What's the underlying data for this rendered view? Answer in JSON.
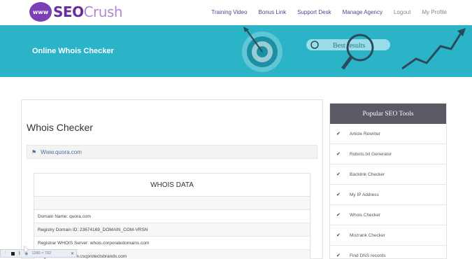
{
  "logo": {
    "globe_text": "www",
    "brand_a": "SEO",
    "brand_b": "Crush"
  },
  "nav": [
    {
      "label": "Training Video"
    },
    {
      "label": "Bonus Link"
    },
    {
      "label": "Support Desk"
    },
    {
      "label": "Manage Agency"
    },
    {
      "label": "Logout"
    },
    {
      "label": "My Profile"
    }
  ],
  "banner": {
    "title": "Online Whois Checker",
    "search_text": "Best results"
  },
  "main": {
    "title": "Whois Checker",
    "domain": "Www.quora.com",
    "whois_header": "WHOIS DATA",
    "rows": [
      "Domain Name: quora.com",
      "Registry Domain ID: 23674169_DOMAIN_COM-VRSN",
      "Registrar WHOIS Server: whois.corporatedomains.com",
      "Registrar URL: www.cscprotectsbrands.com"
    ]
  },
  "sidebar": {
    "title": "Popular SEO Tools",
    "items": [
      "Article Rewriter",
      "Robots.txt Generator",
      "Backlink Checker",
      "My IP Address",
      "Whois Checker",
      "Mozrank Checker",
      "Find DNS records"
    ]
  },
  "toolbar": {
    "size_text": "1280 × 702"
  },
  "colors": {
    "brand_purple": "#6a2b9f",
    "banner_teal": "#2bb3c8",
    "sidebar_head": "#5a5a64"
  }
}
